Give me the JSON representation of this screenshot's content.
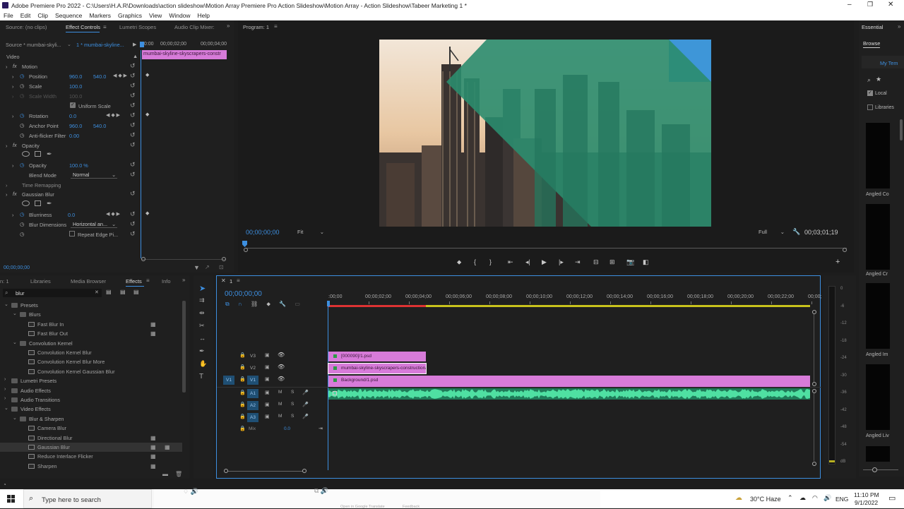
{
  "window": {
    "title": "Adobe Premiere Pro 2022 - C:\\Users\\H.A.R\\Downloads\\action slideshow\\Motion Array Premiere Pro Action Slideshow\\Motion Array - Action Slideshow\\Tabeer Marketing 1 *"
  },
  "menu": [
    "File",
    "Edit",
    "Clip",
    "Sequence",
    "Markers",
    "Graphics",
    "View",
    "Window",
    "Help"
  ],
  "source_panel": {
    "tabs": [
      "Source: (no clips)",
      "Effect Controls",
      "Lumetri Scopes",
      "Audio Clip Mixer:"
    ],
    "source_label": "Source * mumbai-skyli...",
    "sequence_label": "1 * mumbai-skyline...",
    "ruler": [
      "00:00",
      "00;00;02;00",
      "00;00;04;00"
    ],
    "clip_label": "mumbai-skyline-skyscrapers-constr",
    "video_label": "Video",
    "motion": {
      "name": "Motion",
      "position_label": "Position",
      "position_x": "960.0",
      "position_y": "540.0",
      "scale_label": "Scale",
      "scale": "100.0",
      "scale_width_label": "Scale Width",
      "scale_width": "100.0",
      "uniform_label": "Uniform Scale",
      "rotation_label": "Rotation",
      "rotation": "0.0",
      "anchor_label": "Anchor Point",
      "anchor_x": "960.0",
      "anchor_y": "540.0",
      "antiflicker_label": "Anti-flicker Filter",
      "antiflicker": "0.00"
    },
    "opacity": {
      "name": "Opacity",
      "opacity_label": "Opacity",
      "opacity": "100.0 %",
      "blend_label": "Blend Mode",
      "blend": "Normal"
    },
    "time_remapping": "Time Remapping",
    "gaussian": {
      "name": "Gaussian Blur",
      "blurriness_label": "Blurriness",
      "blurriness": "0.0",
      "dim_label": "Blur Dimensions",
      "dim": "Horizontal an...",
      "repeat_label": "Repeat Edge Pi..."
    },
    "timecode": "00;00;00;00"
  },
  "program": {
    "tab": "Program: 1",
    "timecode": "00;00;00;00",
    "fit": "Fit",
    "full": "Full",
    "duration": "00;03;01;19"
  },
  "essential": {
    "tab": "Essential",
    "browse": "Browse",
    "my_templates": "My Tem",
    "local": "Local",
    "libraries": "Libraries",
    "items": [
      "Angled Co",
      "Angled Cr",
      "Angled Im",
      "Angled Liv"
    ]
  },
  "project": {
    "tabs": [
      "n: 1",
      "Libraries",
      "Media Browser",
      "Effects",
      "Info"
    ],
    "search": "blur",
    "tree": [
      {
        "label": "Presets",
        "level": 0,
        "open": true
      },
      {
        "label": "Blurs",
        "level": 1,
        "open": true
      },
      {
        "label": "Fast Blur In",
        "level": 2,
        "badge": true
      },
      {
        "label": "Fast Blur Out",
        "level": 2,
        "badge": true
      },
      {
        "label": "Convolution Kernel",
        "level": 1,
        "open": true
      },
      {
        "label": "Convolution Kernel Blur",
        "level": 2
      },
      {
        "label": "Convolution Kernel Blur More",
        "level": 2
      },
      {
        "label": "Convolution Kernel Gaussian Blur",
        "level": 2
      },
      {
        "label": "Lumetri Presets",
        "level": 0
      },
      {
        "label": "Audio Effects",
        "level": 0
      },
      {
        "label": "Audio Transitions",
        "level": 0
      },
      {
        "label": "Video Effects",
        "level": 0,
        "open": true
      },
      {
        "label": "Blur & Sharpen",
        "level": 1,
        "open": true
      },
      {
        "label": "Camera Blur",
        "level": 2
      },
      {
        "label": "Directional Blur",
        "level": 2,
        "badge": true
      },
      {
        "label": "Gaussian Blur",
        "level": 2,
        "badge": true,
        "selected": true
      },
      {
        "label": "Reduce Interlace Flicker",
        "level": 2,
        "badge": true
      },
      {
        "label": "Sharpen",
        "level": 2,
        "badge": true
      }
    ]
  },
  "timeline": {
    "tab": "1",
    "timecode": "00;00;00;00",
    "ruler": [
      ":00;00",
      "00;00;02;00",
      "00;00;04;00",
      "00;00;06;00",
      "00;00;08;00",
      "00;00;10;00",
      "00;00;12;00",
      "00;00;14;00",
      "00;00;16;00",
      "00;00;18;00",
      "00;00;20;00",
      "00;00;22;00",
      "00;00;"
    ],
    "tracks": [
      "V3",
      "V2",
      "V1",
      "A1",
      "A2",
      "A3"
    ],
    "src_v": "V1",
    "mix_label": "Mix",
    "mix_value": "0.0",
    "clips": {
      "v3": "[000090]/1.psd",
      "v2": "mumbai-skyline-skyscrapers-construction/1",
      "v1": "Background/1.psd"
    },
    "meter": [
      "0",
      "-6",
      "-12",
      "-18",
      "-24",
      "-30",
      "-36",
      "-42",
      "-48",
      "-54",
      "dB"
    ]
  },
  "taskbar": {
    "search": "Type here to search",
    "weather": "30°C  Haze",
    "lang": "ENG",
    "time": "11:10 PM",
    "date": "9/1/2022",
    "bg1": "Open in Google Translate",
    "bg2": "Feedback"
  },
  "colors": {
    "accent": "#3d8fe0",
    "clip_pink": "#d77bd9",
    "audio_green": "#3cc98c",
    "overlay_teal": "#2b8c6e"
  }
}
